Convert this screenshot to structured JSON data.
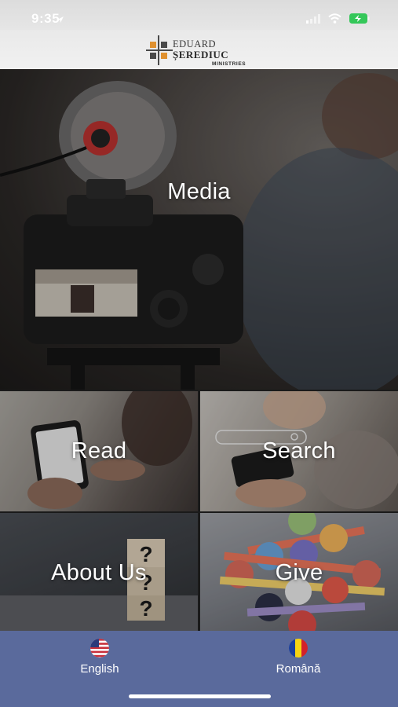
{
  "status_bar": {
    "time": "9:35",
    "icons": [
      "location-arrow-icon",
      "signal-icon",
      "wifi-icon",
      "battery-charging-icon"
    ]
  },
  "header": {
    "logo": {
      "line1": "EDUARD",
      "line2": "ȘEREDIUC",
      "line3": "MINISTRIES"
    }
  },
  "tiles": {
    "media": "Media",
    "read": "Read",
    "search": "Search",
    "about": "About Us",
    "give": "Give"
  },
  "bottom_bar": {
    "english": "English",
    "romanian": "Română"
  },
  "colors": {
    "bottom_bar": "#5a6a9c",
    "logo_orange": "#e0912f",
    "logo_gray": "#4a4a4a"
  }
}
